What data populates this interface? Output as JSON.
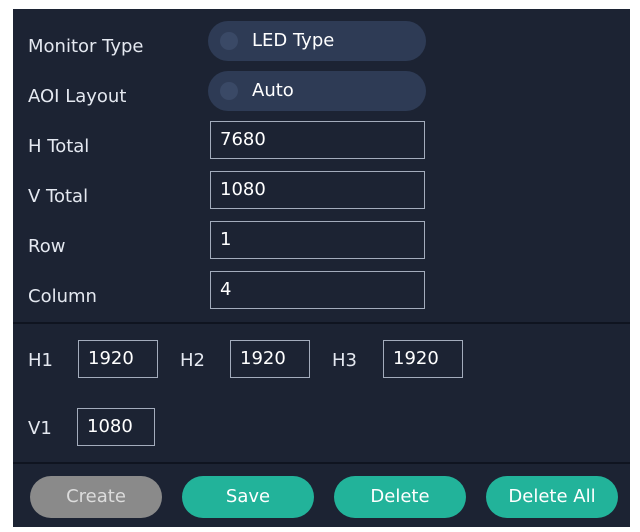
{
  "form": {
    "monitor_type": {
      "label": "Monitor Type",
      "value": "LED Type"
    },
    "aoi_layout": {
      "label": "AOI Layout",
      "value": "Auto"
    },
    "h_total": {
      "label": "H Total",
      "value": "7680"
    },
    "v_total": {
      "label": "V Total",
      "value": "1080"
    },
    "row": {
      "label": "Row",
      "value": "1"
    },
    "column": {
      "label": "Column",
      "value": "4"
    }
  },
  "segments": {
    "h1": {
      "label": "H1",
      "value": "1920"
    },
    "h2": {
      "label": "H2",
      "value": "1920"
    },
    "h3": {
      "label": "H3",
      "value": "1920"
    },
    "v1": {
      "label": "V1",
      "value": "1080"
    }
  },
  "buttons": {
    "create": "Create",
    "save": "Save",
    "delete": "Delete",
    "delete_all": "Delete All"
  },
  "colors": {
    "panel_bg": "#1c2333",
    "pill_bg": "#2e3b55",
    "accent_teal": "#22b39a",
    "disabled_gray": "#8a8a8a"
  }
}
